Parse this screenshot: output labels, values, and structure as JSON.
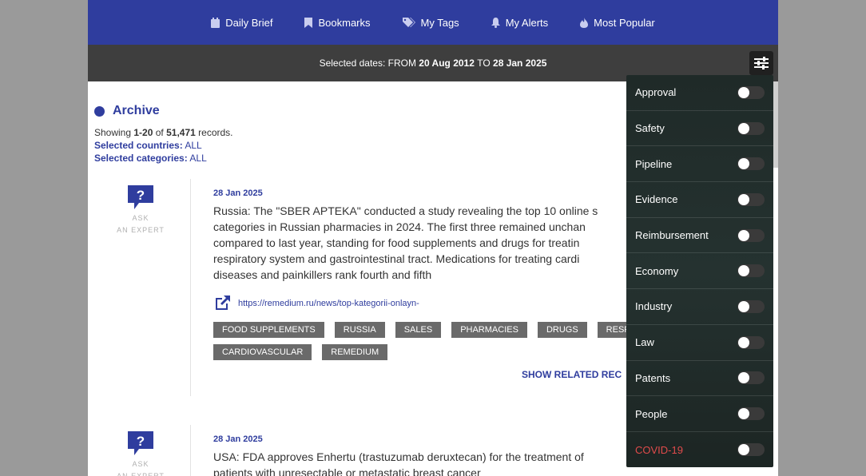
{
  "nav": {
    "items": [
      {
        "label": "Daily Brief",
        "icon": "calendar-icon"
      },
      {
        "label": "Bookmarks",
        "icon": "bookmark-icon"
      },
      {
        "label": "My Tags",
        "icon": "tags-icon"
      },
      {
        "label": "My Alerts",
        "icon": "bell-icon"
      },
      {
        "label": "Most Popular",
        "icon": "flame-icon"
      }
    ]
  },
  "datebar": {
    "prefix": "Selected dates: FROM",
    "from": "20 Aug 2012",
    "to_label": "TO",
    "to": "28 Jan 2025"
  },
  "archive": {
    "title": "Archive",
    "showing_label": "Showing",
    "range": "1-20",
    "of_label": "of",
    "total": "51,471",
    "records_label": "records.",
    "countries_label": "Selected countries:",
    "countries_value": "ALL",
    "categories_label": "Selected categories:",
    "categories_value": "ALL"
  },
  "ask": {
    "line1": "ASK",
    "line2": "AN EXPERT"
  },
  "records": [
    {
      "date": "28 Jan 2025",
      "lines": [
        "Russia: The \"SBER APTEKA\" conducted a study revealing the top 10 online s",
        "categories in Russian pharmacies in 2024. The first three remained unchan",
        "compared to last year, standing for food supplements and drugs for treatin",
        "respiratory system and gastrointestinal tract. Medications for treating cardi",
        "diseases and painkillers rank fourth and fifth"
      ],
      "link": "https://remedium.ru/news/top-kategorii-onlayn-",
      "tags": [
        "FOOD SUPPLEMENTS",
        "RUSSIA",
        "SALES",
        "PHARMACIES",
        "DRUGS",
        "RESP",
        "CARDIOVASCULAR",
        "REMEDIUM"
      ],
      "related": "SHOW RELATED REC"
    },
    {
      "date": "28 Jan 2025",
      "lines": [
        "USA: FDA approves Enhertu (trastuzumab deruxtecan) for the treatment of",
        "patients with unresectable or metastatic breast cancer"
      ]
    }
  ],
  "panel": {
    "items": [
      {
        "label": "Approval"
      },
      {
        "label": "Safety"
      },
      {
        "label": "Pipeline"
      },
      {
        "label": "Evidence"
      },
      {
        "label": "Reimbursement"
      },
      {
        "label": "Economy"
      },
      {
        "label": "Industry"
      },
      {
        "label": "Law"
      },
      {
        "label": "Patents"
      },
      {
        "label": "People"
      },
      {
        "label": "COVID-19",
        "highlight": true
      }
    ]
  },
  "colors": {
    "brand_blue": "#2f3d9e",
    "date_bar": "#3e3e3e",
    "tag_bg": "#6a6a6a",
    "covid_red": "#e04b4b"
  }
}
